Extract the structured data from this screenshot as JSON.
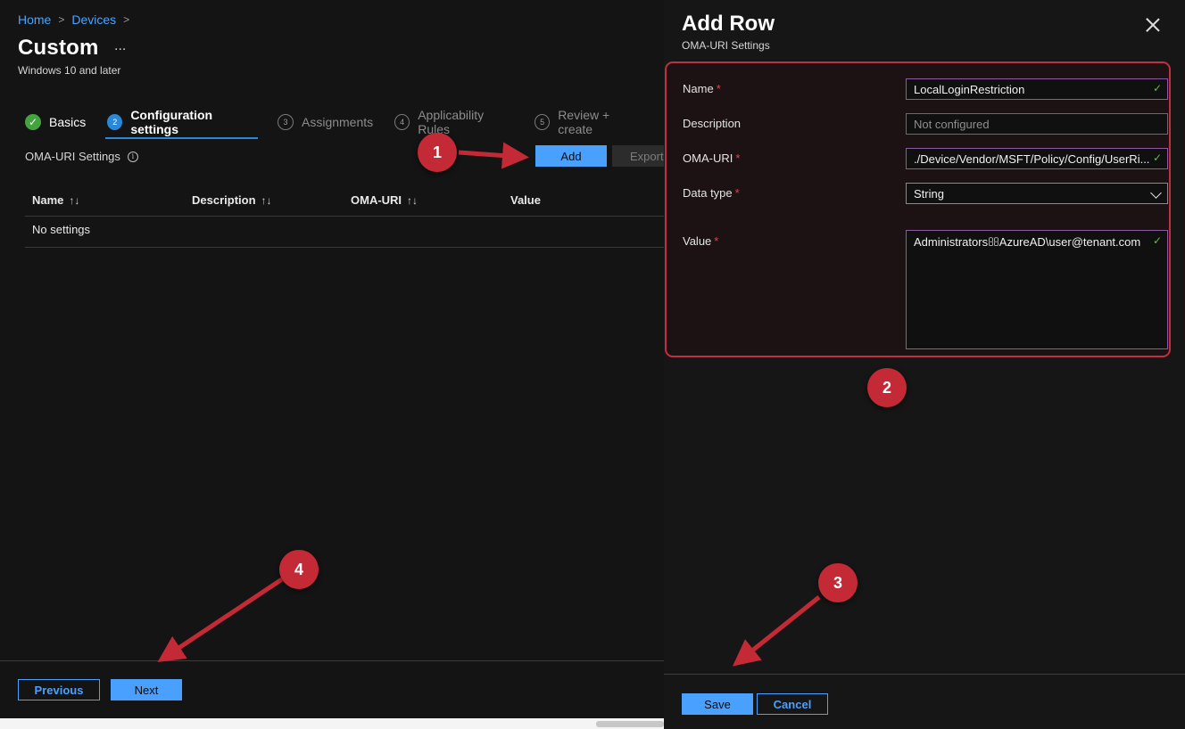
{
  "breadcrumb": {
    "home": "Home",
    "devices": "Devices",
    "sep": ">"
  },
  "header": {
    "title": "Custom",
    "more": "...",
    "subtitle": "Windows 10 and later"
  },
  "steps": [
    {
      "num": "✓",
      "label": "Basics",
      "state": "done"
    },
    {
      "num": "2",
      "label": "Configuration settings",
      "state": "active"
    },
    {
      "num": "3",
      "label": "Assignments",
      "state": "pending"
    },
    {
      "num": "4",
      "label": "Applicability Rules",
      "state": "pending"
    },
    {
      "num": "5",
      "label": "Review + create",
      "state": "pending"
    }
  ],
  "oma_section": {
    "label": "OMA-URI Settings",
    "info": "i"
  },
  "toolbar": {
    "add_label": "Add",
    "export_label": "Export"
  },
  "table": {
    "columns": [
      "Name",
      "Description",
      "OMA-URI",
      "Value"
    ],
    "sort_glyph": "↑↓",
    "empty_text": "No settings"
  },
  "footer": {
    "previous_label": "Previous",
    "next_label": "Next"
  },
  "panel": {
    "title": "Add Row",
    "subtitle": "OMA-URI Settings",
    "required_mark": "*",
    "check_glyph": "✓",
    "fields": {
      "name": {
        "label": "Name",
        "value": "LocalLoginRestriction"
      },
      "description": {
        "label": "Description",
        "placeholder": "Not configured"
      },
      "oma_uri": {
        "label": "OMA-URI",
        "value": "./Device/Vendor/MSFT/Policy/Config/UserRi..."
      },
      "data_type": {
        "label": "Data type",
        "value": "String"
      },
      "value": {
        "label": "Value",
        "value": "AdministratorsAzureAD\\user@tenant.com"
      }
    },
    "save_label": "Save",
    "cancel_label": "Cancel"
  },
  "annotations": [
    "1",
    "2",
    "3",
    "4"
  ],
  "colors": {
    "accent": "#4aa0ff",
    "annotation": "#c32a36",
    "success": "#45a33f",
    "required": "#e0444f"
  }
}
